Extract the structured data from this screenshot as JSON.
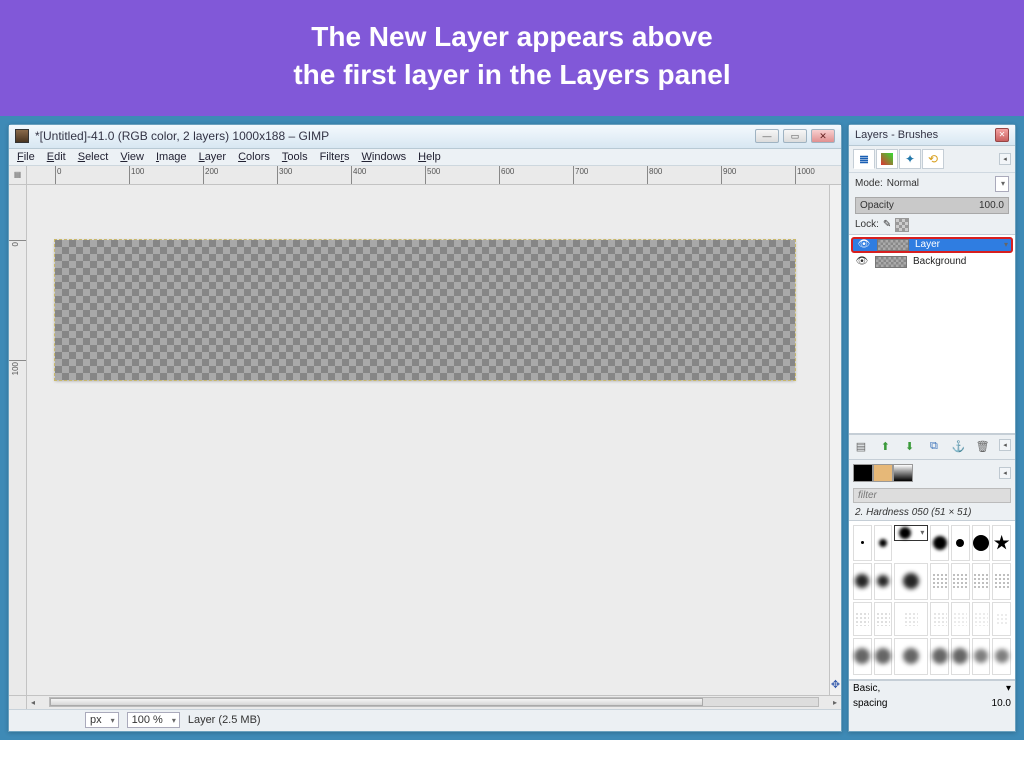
{
  "banner": {
    "line1": "The New Layer appears above",
    "line2": "the first layer in the Layers panel"
  },
  "main_window": {
    "title": "*[Untitled]-41.0 (RGB color, 2 layers) 1000x188 – GIMP",
    "menus": [
      "File",
      "Edit",
      "Select",
      "View",
      "Image",
      "Layer",
      "Colors",
      "Tools",
      "Filters",
      "Windows",
      "Help"
    ],
    "ruler_marks": [
      "0",
      "100",
      "200",
      "300",
      "400",
      "500",
      "600",
      "700",
      "800",
      "900",
      "1000"
    ],
    "vruler_marks": [
      "0",
      "100"
    ],
    "status": {
      "unit": "px",
      "zoom": "100 %",
      "info": "Layer (2.5 MB)"
    }
  },
  "layers_panel": {
    "title": "Layers - Brushes",
    "mode_label": "Mode:",
    "mode_value": "Normal",
    "opacity_label": "Opacity",
    "opacity_value": "100.0",
    "lock_label": "Lock:",
    "layers": [
      {
        "name": "Layer",
        "selected": true
      },
      {
        "name": "Background",
        "selected": false
      }
    ],
    "filter_placeholder": "filter",
    "brush_label": "2. Hardness 050 (51 × 51)",
    "basic_label": "Basic,",
    "spacing_label": "spacing",
    "spacing_value": "10.0"
  }
}
